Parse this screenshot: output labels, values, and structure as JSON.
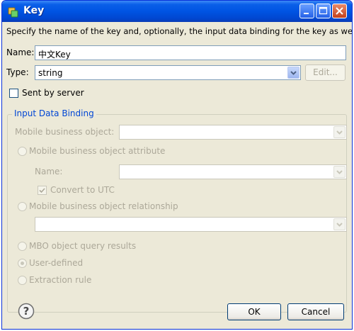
{
  "window": {
    "title": "Key"
  },
  "description": "Specify the name of the key and, optionally, the input data binding for the key as well.",
  "name_field": {
    "label": "Name:",
    "value": "中文Key"
  },
  "type_field": {
    "label": "Type:",
    "value": "string",
    "edit_label": "Edit..."
  },
  "sent_by_server": {
    "label": "Sent by server",
    "checked": false
  },
  "input_data_binding": {
    "title": "Input Data Binding",
    "mbo_label": "Mobile business object:",
    "mbo_attribute_label": "Mobile business object attribute",
    "attr_name_label": "Name:",
    "convert_utc_label": "Convert to UTC",
    "mbo_relationship_label": "Mobile business object relationship",
    "mbo_query_label": "MBO object query results",
    "user_defined_label": "User-defined",
    "extraction_rule_label": "Extraction rule"
  },
  "buttons": {
    "ok": "OK",
    "cancel": "Cancel"
  },
  "colors": {
    "title_bar": "#0054e3",
    "group_title": "#0046d5",
    "disabled_text": "#aca899",
    "dialog_bg": "#ece9d8"
  }
}
